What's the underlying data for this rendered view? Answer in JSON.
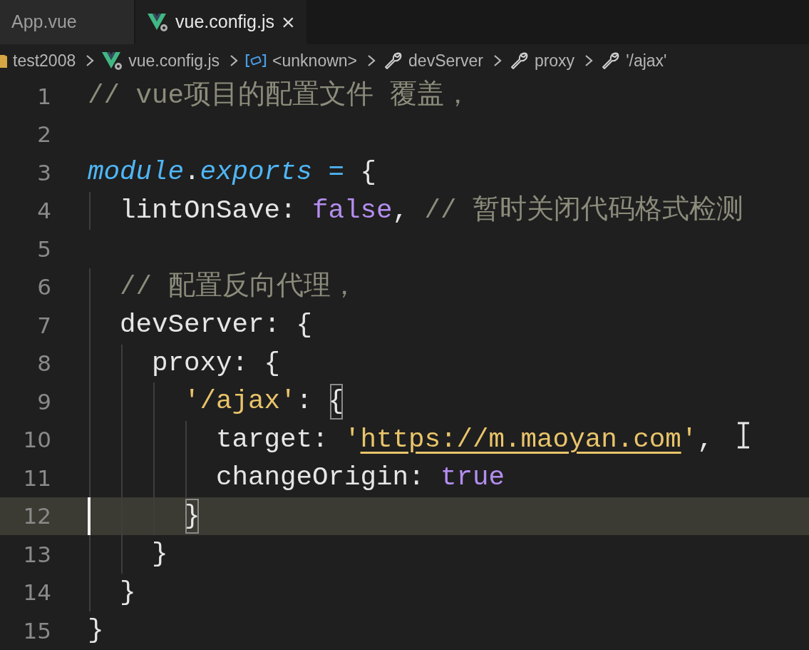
{
  "tabs": [
    {
      "label": "App.vue",
      "selected": false,
      "kind": "plain"
    },
    {
      "label": "vue.config.js",
      "selected": true,
      "kind": "vue",
      "close": "×"
    }
  ],
  "breadcrumbs": [
    {
      "label": "test2008",
      "kind": "folder"
    },
    {
      "label": "vue.config.js",
      "kind": "vue"
    },
    {
      "label": "<unknown>",
      "kind": "symbol"
    },
    {
      "label": "devServer",
      "kind": "wrench"
    },
    {
      "label": "proxy",
      "kind": "wrench"
    },
    {
      "label": "'/ajax'",
      "kind": "wrench"
    }
  ],
  "lines": [
    {
      "number": "1",
      "current": false,
      "tokens": [
        {
          "text": "// vue项目的配置文件 覆盖，",
          "kind": "comment"
        }
      ]
    },
    {
      "number": "2",
      "current": false
    },
    {
      "number": "3",
      "current": false,
      "tokens": [
        {
          "text": "module",
          "kind": "keyword"
        },
        {
          "text": ".",
          "kind": "plain"
        },
        {
          "text": "exports",
          "kind": "keyword"
        },
        {
          "text": " = ",
          "kind": "operator"
        },
        {
          "text": "{",
          "kind": "plain"
        }
      ]
    },
    {
      "number": "4",
      "current": false,
      "tokens": [
        {
          "text": "  lintOnSave: ",
          "kind": "plain"
        },
        {
          "text": "false",
          "kind": "boolean"
        },
        {
          "text": ", ",
          "kind": "plain"
        },
        {
          "text": "// 暂时关闭代码格式检测",
          "kind": "comment"
        }
      ]
    },
    {
      "number": "5",
      "current": false
    },
    {
      "number": "6",
      "current": false,
      "tokens": [
        {
          "text": "  // 配置反向代理，",
          "kind": "comment"
        }
      ]
    },
    {
      "number": "7",
      "current": false,
      "tokens": [
        {
          "text": "  devServer: {",
          "kind": "plain"
        }
      ]
    },
    {
      "number": "8",
      "current": false,
      "tokens": [
        {
          "text": "    proxy: {",
          "kind": "plain"
        }
      ]
    },
    {
      "number": "9",
      "current": false,
      "tokens": [
        {
          "text": "      '/ajax'",
          "kind": "string"
        },
        {
          "text": ": ",
          "kind": "plain"
        },
        {
          "text": "{",
          "kind": "matched-bracket"
        }
      ]
    },
    {
      "number": "10",
      "current": false,
      "tokens": [
        {
          "text": "        target: ",
          "kind": "plain"
        },
        {
          "text": "'",
          "kind": "string"
        },
        {
          "text": "https://m.maoyan.com",
          "kind": "link"
        },
        {
          "text": "'",
          "kind": "string"
        },
        {
          "text": ",",
          "kind": "plain"
        }
      ]
    },
    {
      "number": "11",
      "current": false,
      "tokens": [
        {
          "text": "        changeOrigin: ",
          "kind": "plain"
        },
        {
          "text": "true",
          "kind": "boolean"
        }
      ]
    },
    {
      "number": "12",
      "current": true,
      "tokens": [
        {
          "text": "      }",
          "kind": "matched-bracket"
        }
      ]
    },
    {
      "number": "13",
      "current": false,
      "tokens": [
        {
          "text": "    }",
          "kind": "plain"
        }
      ]
    },
    {
      "number": "14",
      "current": false,
      "tokens": [
        {
          "text": "  }",
          "kind": "plain"
        }
      ]
    },
    {
      "number": "15",
      "current": false,
      "tokens": [
        {
          "text": "}",
          "kind": "plain"
        }
      ]
    }
  ]
}
